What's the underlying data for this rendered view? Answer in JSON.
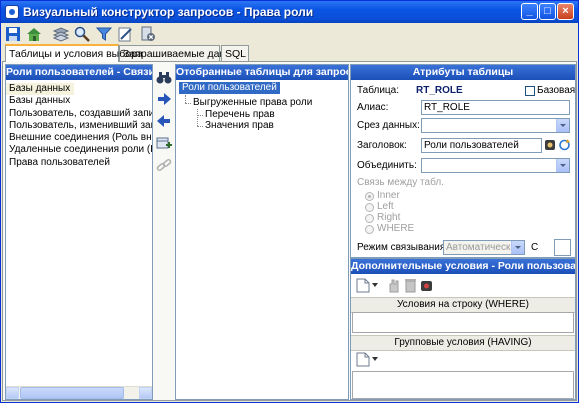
{
  "window": {
    "title": "Визуальный конструктор запросов - Права роли",
    "buttons": {
      "minimize": "_",
      "maximize": "□",
      "close": "×"
    }
  },
  "toolbar": {
    "icons": [
      "save-icon",
      "home-icon",
      "layers-icon",
      "search-icon",
      "filter-icon",
      "edit-icon",
      "exit-icon"
    ]
  },
  "tabs": [
    {
      "label": "Таблицы и условия выбора",
      "active": true
    },
    {
      "label": "Запрашиваемые данные",
      "active": false
    },
    {
      "label": "SQL",
      "active": false
    }
  ],
  "links_panel": {
    "title": "Роли пользователей - Связи",
    "items": [
      "Базы данных",
      "Базы данных",
      "Пользователь, создавший запись (Е",
      "Пользователь, изменивший запись",
      "Внешние соединения (Роль внешне",
      "Удаленные соединения роли (Роль",
      "Права пользователей"
    ],
    "selected_index": 0
  },
  "side_buttons": [
    "binoculars-icon",
    "arrow-right-icon",
    "arrow-left-icon",
    "add-table-icon",
    "link-icon"
  ],
  "tables_panel": {
    "title": "Отобранные таблицы для запроса",
    "root": "Роли пользователей",
    "child": "Выгруженные права роли",
    "grandchildren": [
      "Перечень прав",
      "Значения прав"
    ]
  },
  "attributes": {
    "title": "Атрибуты таблицы",
    "table_label": "Таблица:",
    "table_value": "RT_ROLE",
    "base_label": "Базовая",
    "alias_label": "Алиас:",
    "alias_value": "RT_ROLE",
    "slice_label": "Срез данных:",
    "slice_value": "",
    "header_label": "Заголовок:",
    "header_value": "Роли пользователей",
    "join_label": "Объединить:",
    "join_value": "",
    "relation_label": "Связь между табл.",
    "relation_options": [
      "Inner",
      "Left",
      "Right",
      "WHERE"
    ],
    "relation_selected": "Inner",
    "mode_label": "Режим связывания:",
    "mode_value": "Автоматически",
    "c_label": "С",
    "c_value": ""
  },
  "conditions": {
    "title": "Дополнительные условия - Роли пользователей",
    "where_label": "Условия на строку (WHERE)",
    "where_value": "",
    "having_label": "Групповые условия (HAVING)",
    "having_value": ""
  },
  "colors": {
    "title_blue": "#0a54e3",
    "panel_header": "#2a62c8",
    "selection": "#316ac5",
    "tab_highlight": "#f9b13d"
  }
}
